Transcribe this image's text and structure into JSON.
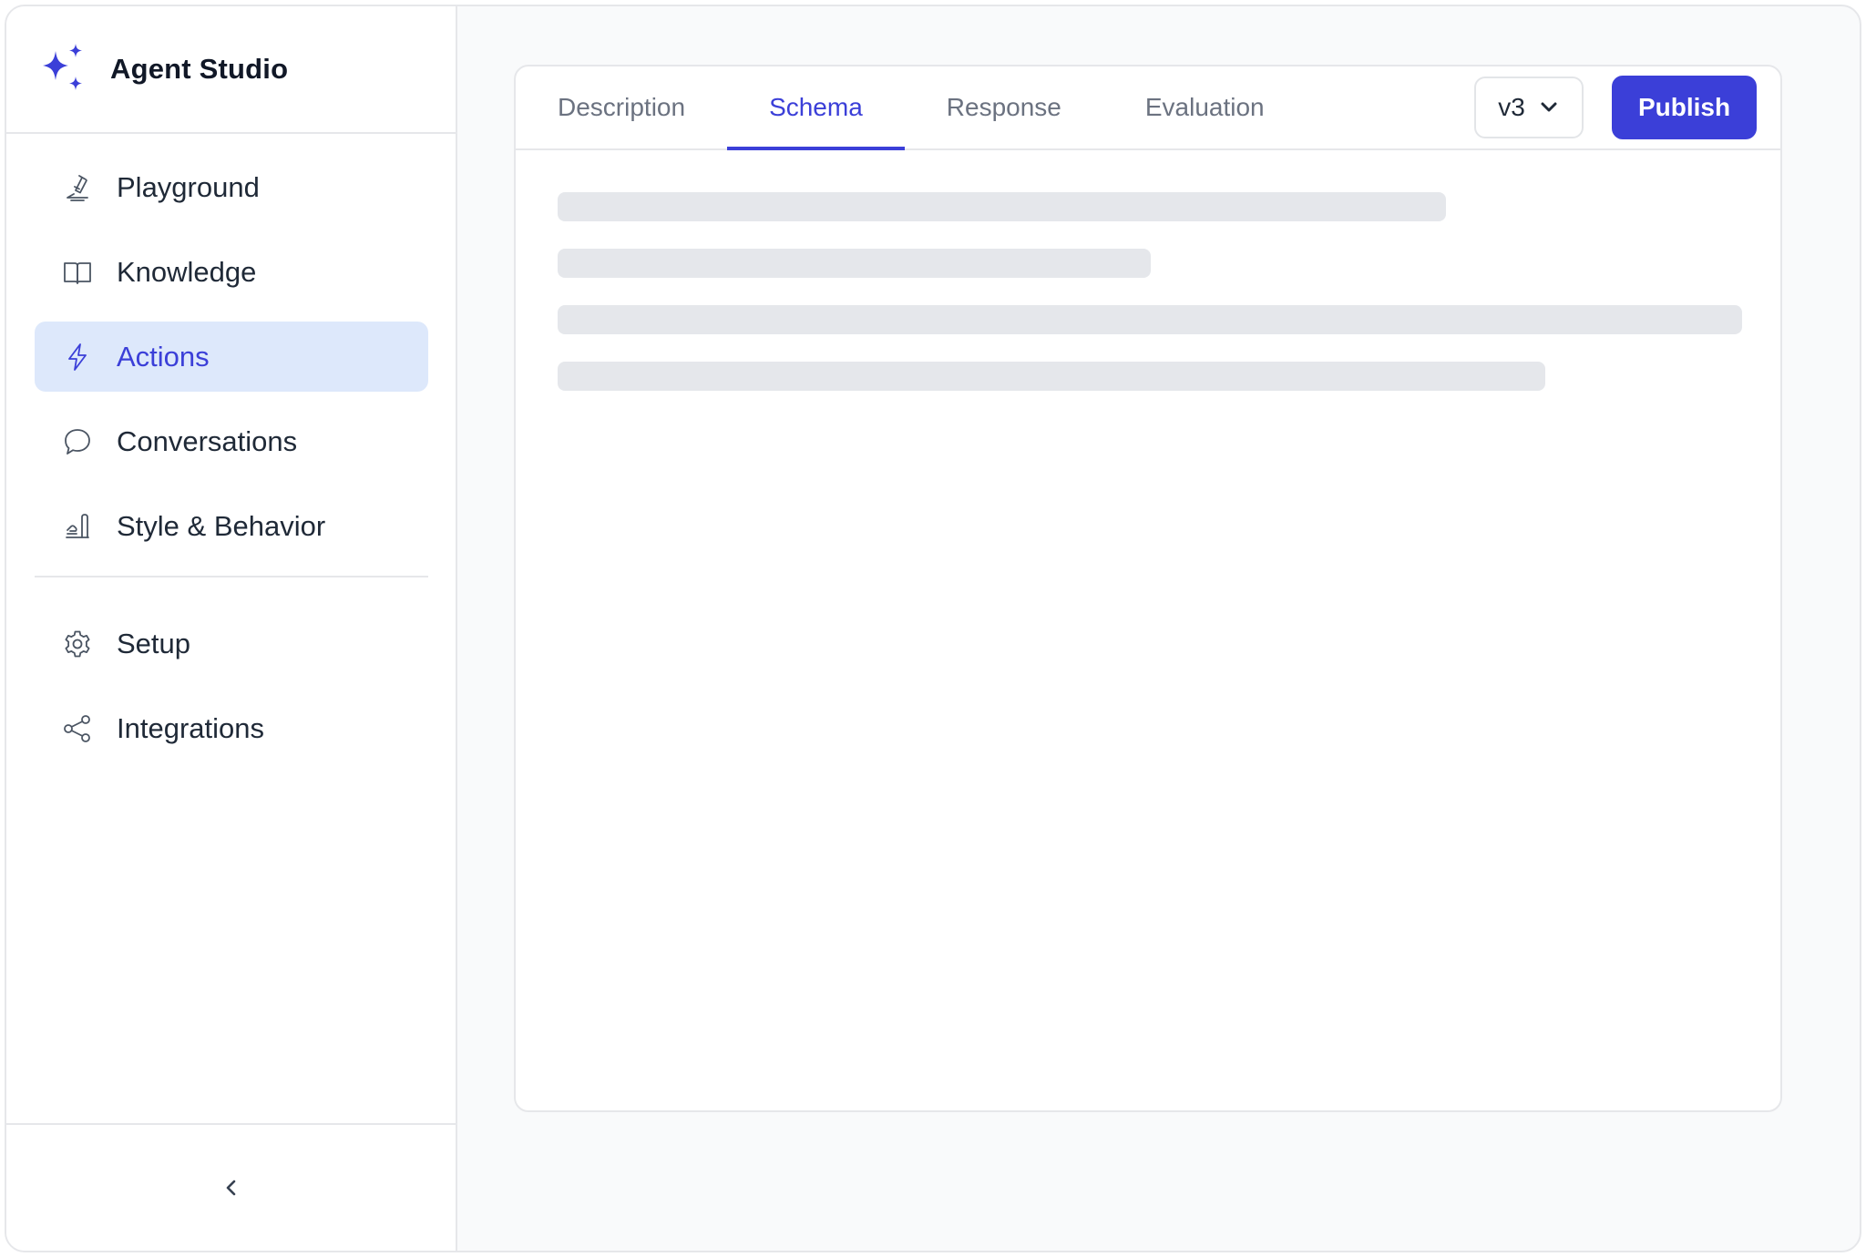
{
  "app": {
    "name": "Agent Studio",
    "accent_color": "#3b3fd8",
    "active_bg": "#dde8fb"
  },
  "sidebar": {
    "items": [
      {
        "label": "Playground",
        "icon": "flask-icon",
        "active": false
      },
      {
        "label": "Knowledge",
        "icon": "book-icon",
        "active": false
      },
      {
        "label": "Actions",
        "icon": "lightning-icon",
        "active": true
      },
      {
        "label": "Conversations",
        "icon": "chat-bubble-icon",
        "active": false
      },
      {
        "label": "Style & Behavior",
        "icon": "style-icon",
        "active": false
      }
    ],
    "secondary_items": [
      {
        "label": "Setup",
        "icon": "gear-icon"
      },
      {
        "label": "Integrations",
        "icon": "share-icon"
      }
    ],
    "collapse_icon": "chevron-left-icon"
  },
  "editor": {
    "tabs": [
      {
        "label": "Description",
        "active": false
      },
      {
        "label": "Schema",
        "active": true
      },
      {
        "label": "Response",
        "active": false
      },
      {
        "label": "Evaluation",
        "active": false
      }
    ],
    "version": "v3",
    "publish_label": "Publish",
    "content_state": "loading"
  }
}
